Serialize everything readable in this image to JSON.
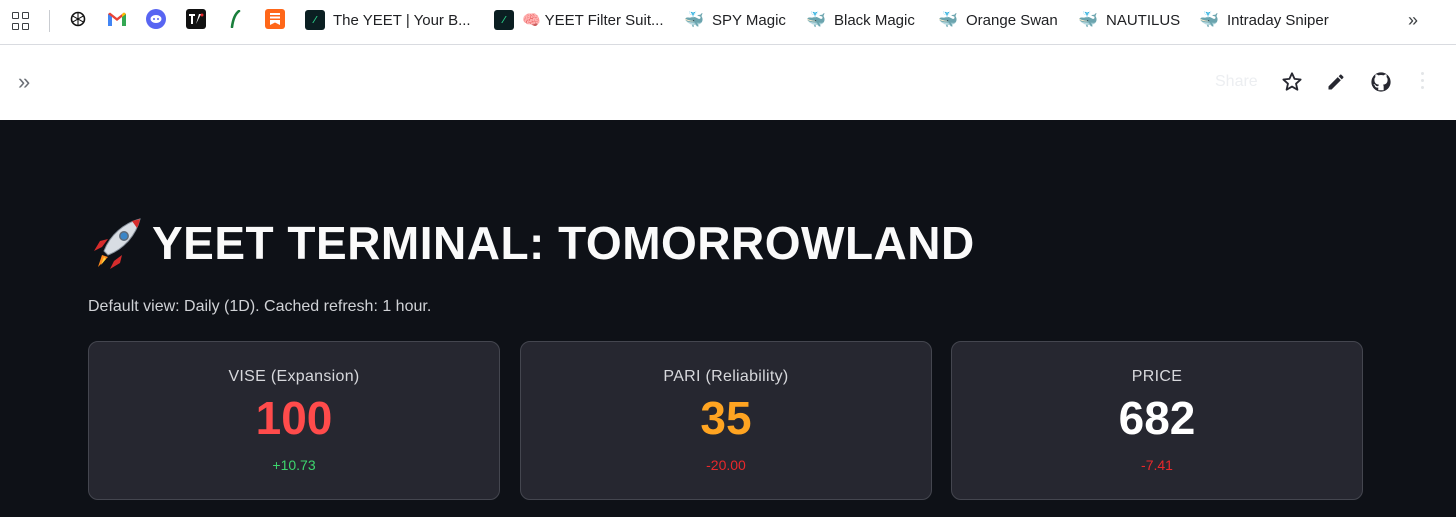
{
  "bookmarks": {
    "items": [
      {
        "label": "The YEET | Your B...",
        "icon": "yeet-logo-icon"
      },
      {
        "label": "🧠 YEET Filter Suit...",
        "icon": "yeet-logo-icon"
      },
      {
        "label": "SPY Magic",
        "icon": "whale-icon"
      },
      {
        "label": "Black Magic",
        "icon": "whale-icon"
      },
      {
        "label": "Orange Swan",
        "icon": "whale-icon"
      },
      {
        "label": "NAUTILUS",
        "icon": "whale-icon"
      },
      {
        "label": "Intraday Sniper",
        "icon": "whale-icon"
      }
    ],
    "favicons": [
      "chatgpt-icon",
      "gmail-icon",
      "discord-icon",
      "tradingview-icon",
      "robinhood-icon",
      "substack-icon"
    ]
  },
  "header": {
    "share_label": "Share"
  },
  "main": {
    "title": "YEET TERMINAL: TOMORROWLAND",
    "caption": "Default view: Daily (1D). Cached refresh: 1 hour.",
    "metrics": [
      {
        "label": "VISE (Expansion)",
        "value": "100",
        "delta": "+10.73",
        "value_color": "#ff4b4b",
        "delta_color": "#3dd56d"
      },
      {
        "label": "PARI (Reliability)",
        "value": "35",
        "delta": "-20.00",
        "value_color": "#ffa421",
        "delta_color": "#e8282b"
      },
      {
        "label": "PRICE",
        "value": "682",
        "delta": "-7.41",
        "value_color": "#ffffff",
        "delta_color": "#e8282b"
      }
    ]
  },
  "colors": {
    "background": "#0e1117",
    "card": "#262730",
    "card_border": "#44464f"
  }
}
